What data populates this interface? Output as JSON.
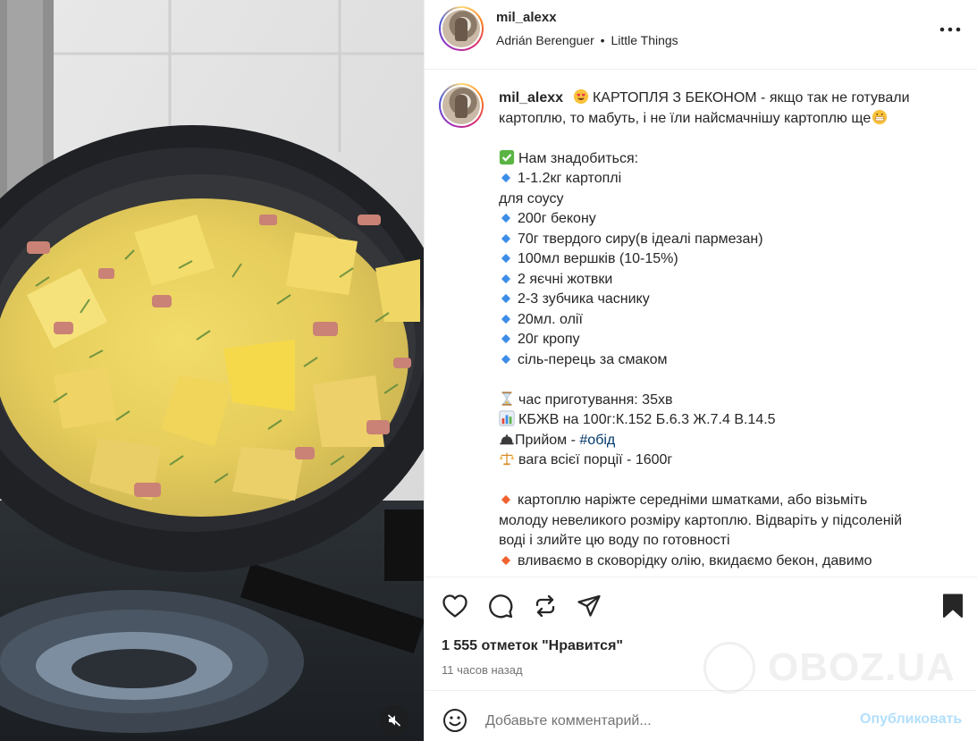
{
  "colors": {
    "text": "#262626",
    "secondary": "#737373",
    "link": "#00376b",
    "publish_disabled": "#b2dffc"
  },
  "media": {
    "mute_icon": "speaker-muted-icon"
  },
  "header": {
    "username": "mil_alexx",
    "audio_artist": "Adrián Berenguer",
    "audio_separator": "•",
    "audio_track": "Little Things",
    "more_icon": "more-horizontal-icon"
  },
  "caption": {
    "username": "mil_alexx",
    "intro": [
      " КАРТОПЛЯ З БЕКОНОМ - якщо так не готували",
      "картоплю, то мабуть, і не їли найсмачнішу картоплю ще"
    ],
    "need_title": "Нам знадобиться:",
    "potato": "1-1.2кг картоплі",
    "sauce_label": "для соусу",
    "ingredients": [
      "200г бекону",
      "70г твердого сиру(в ідеалі пармезан)",
      "100мл вершків (10-15%)",
      "2 яєчні жотвки",
      "2-3 зубчика часнику",
      "20мл. олії",
      "20г кропу",
      "сіль-перець за смаком"
    ],
    "cook_time": "час приготування: 35хв",
    "nutrition": "КБЖВ на 100г:К.152 Б.6.3 Ж.7.4 В.14.5",
    "meal_prefix": "Прийом - ",
    "meal_hashtag": "#обід",
    "portion_weight": "вага всієї порції - 1600г",
    "step1": [
      "картоплю наріжте середніми шматками, або візьміть",
      "молоду невеликого розміру картоплю. Відваріть у підсоленій",
      "воді і злийте цю воду по готовності"
    ],
    "step2": [
      "вливаємо в сковорідку олію, вкидаємо бекон, давимо"
    ]
  },
  "actions": {
    "like_icon": "heart-icon",
    "comment_icon": "comment-icon",
    "repost_icon": "repost-icon",
    "share_icon": "share-icon",
    "save_icon": "bookmark-icon",
    "likes_text": "1 555 отметок \"Нравится\"",
    "timestamp": "11 часов назад"
  },
  "watermark": {
    "text": "OBOZ.UA"
  },
  "comment": {
    "placeholder": "Добавьте комментарий...",
    "publish_label": "Опубликовать",
    "emoji_icon": "smiley-icon"
  }
}
